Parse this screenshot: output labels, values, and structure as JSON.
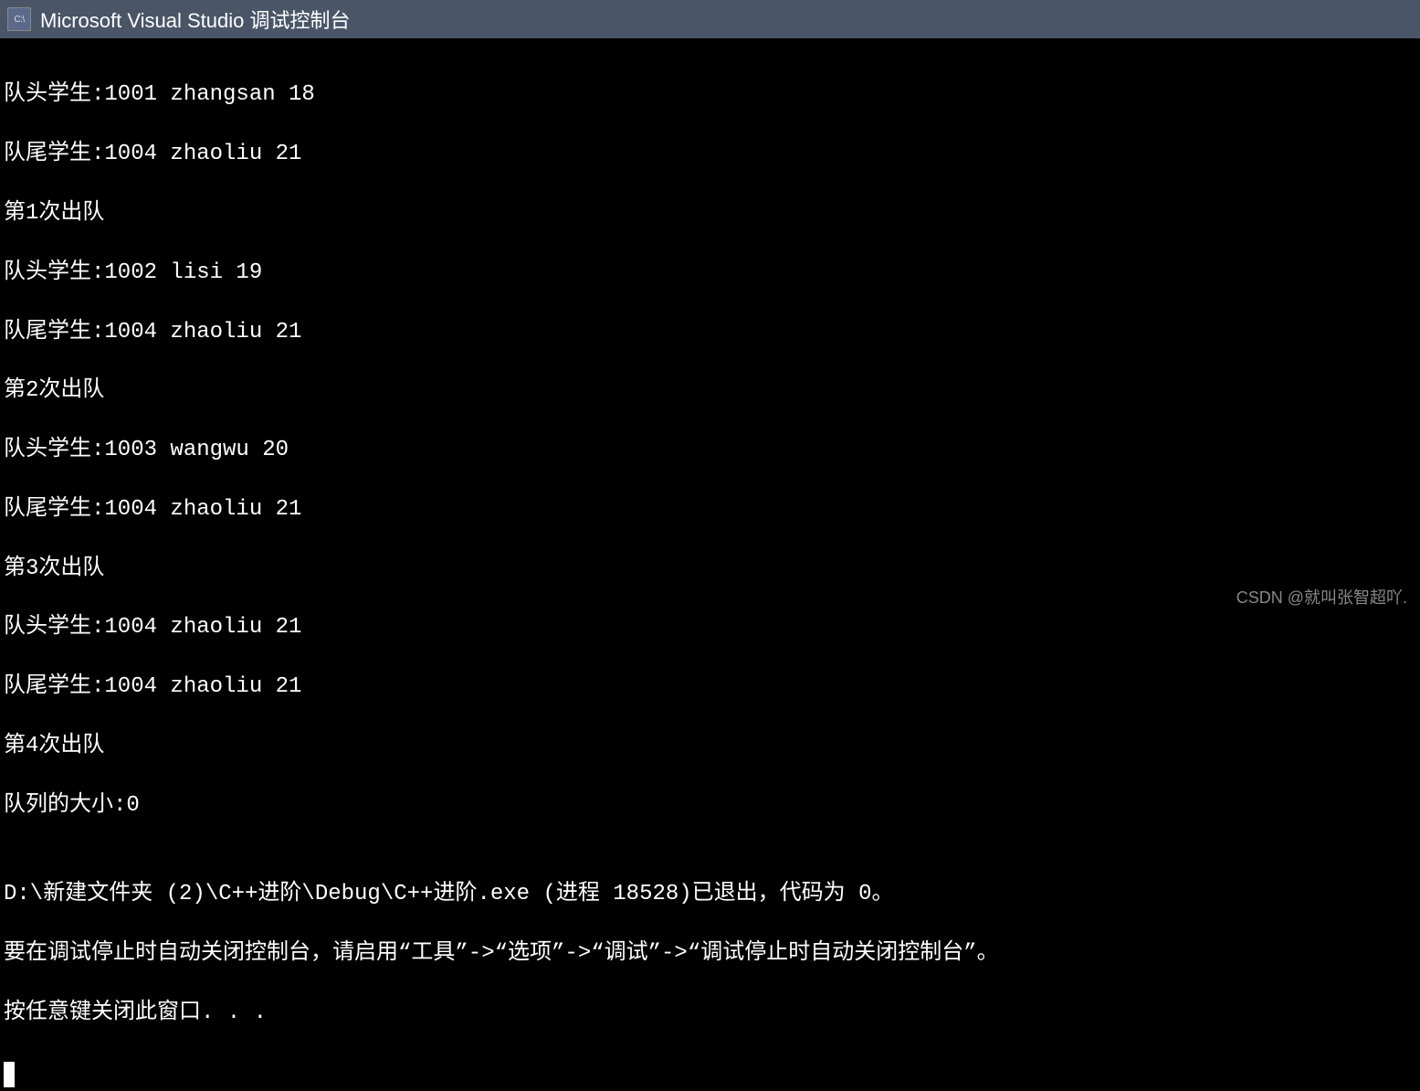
{
  "window": {
    "title": "Microsoft Visual Studio 调试控制台",
    "icon_label": "C:\\"
  },
  "console": {
    "lines": [
      "队头学生:1001 zhangsan 18",
      "队尾学生:1004 zhaoliu 21",
      "第1次出队",
      "队头学生:1002 lisi 19",
      "队尾学生:1004 zhaoliu 21",
      "第2次出队",
      "队头学生:1003 wangwu 20",
      "队尾学生:1004 zhaoliu 21",
      "第3次出队",
      "队头学生:1004 zhaoliu 21",
      "队尾学生:1004 zhaoliu 21",
      "第4次出队",
      "队列的大小:0",
      "",
      "D:\\新建文件夹 (2)\\C++进阶\\Debug\\C++进阶.exe (进程 18528)已退出，代码为 0。",
      "要在调试停止时自动关闭控制台，请启用“工具”->“选项”->“调试”->“调试停止时自动关闭控制台”。",
      "按任意键关闭此窗口. . ."
    ]
  },
  "watermark": {
    "text": "CSDN @就叫张智超吖."
  }
}
